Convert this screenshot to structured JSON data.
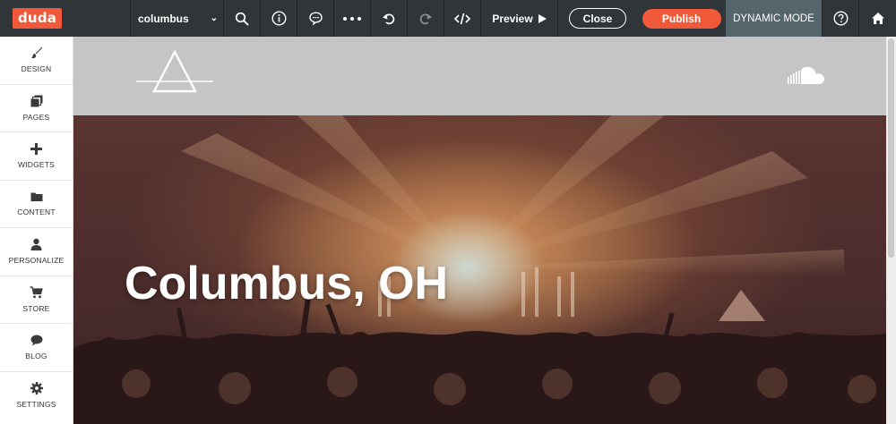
{
  "brand": {
    "logo_text": "duda",
    "accent_color": "#f05a3a"
  },
  "topbar": {
    "site_name": "columbus",
    "icons": [
      "search-icon",
      "info-icon",
      "chat-icon",
      "more-icon",
      "undo-icon",
      "redo-icon",
      "code-icon"
    ],
    "preview_label": "Preview",
    "close_label": "Close",
    "publish_label": "Publish",
    "dynamic_mode_label": "DYNAMIC MODE"
  },
  "sidebar": {
    "items": [
      {
        "label": "DESIGN",
        "icon": "brush-icon"
      },
      {
        "label": "PAGES",
        "icon": "pages-icon"
      },
      {
        "label": "WIDGETS",
        "icon": "plus-icon"
      },
      {
        "label": "CONTENT",
        "icon": "folder-icon"
      },
      {
        "label": "PERSONALIZE",
        "icon": "person-icon"
      },
      {
        "label": "STORE",
        "icon": "cart-icon"
      },
      {
        "label": "BLOG",
        "icon": "speech-bubble-icon"
      },
      {
        "label": "SETTINGS",
        "icon": "gear-icon"
      }
    ]
  },
  "site": {
    "header_logo": "triangle-logo",
    "header_social": "soundcloud-icon",
    "hero_title": "Columbus, OH"
  }
}
